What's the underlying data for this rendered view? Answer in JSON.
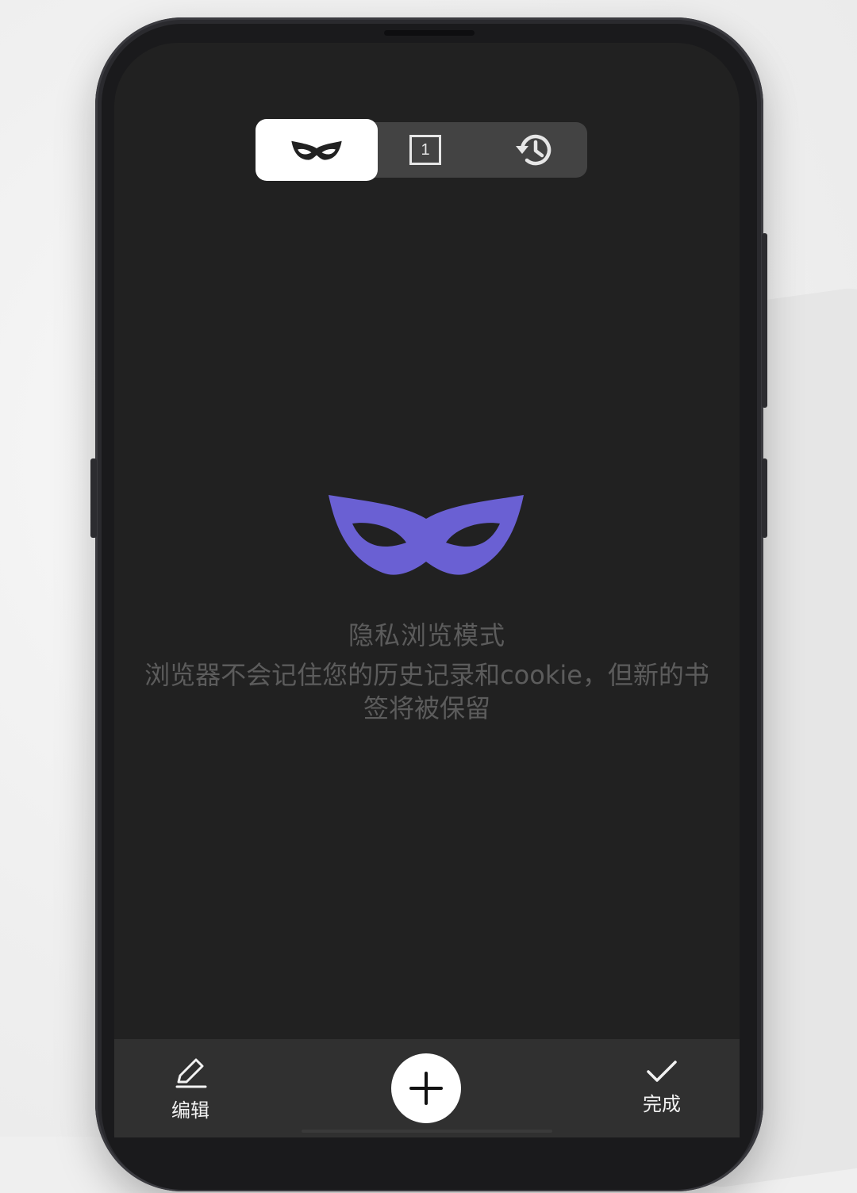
{
  "tabs": [
    {
      "icon": "incognito-mask-icon",
      "selected": true
    },
    {
      "icon": "tab-count-icon",
      "label": "1",
      "selected": false
    },
    {
      "icon": "history-icon",
      "selected": false
    }
  ],
  "private_mode": {
    "icon": "incognito-mask-icon",
    "title": "隐私浏览模式",
    "description": "浏览器不会记住您的历史记录和cookie，但新的书签将被保留"
  },
  "bottom_bar": {
    "edit_label": "编辑",
    "add_icon": "plus-icon",
    "done_label": "完成"
  },
  "colors": {
    "accent": "#6a60d3",
    "screen_bg": "#212121",
    "bar_bg": "#303030",
    "muted_text": "#5c5c5c"
  }
}
